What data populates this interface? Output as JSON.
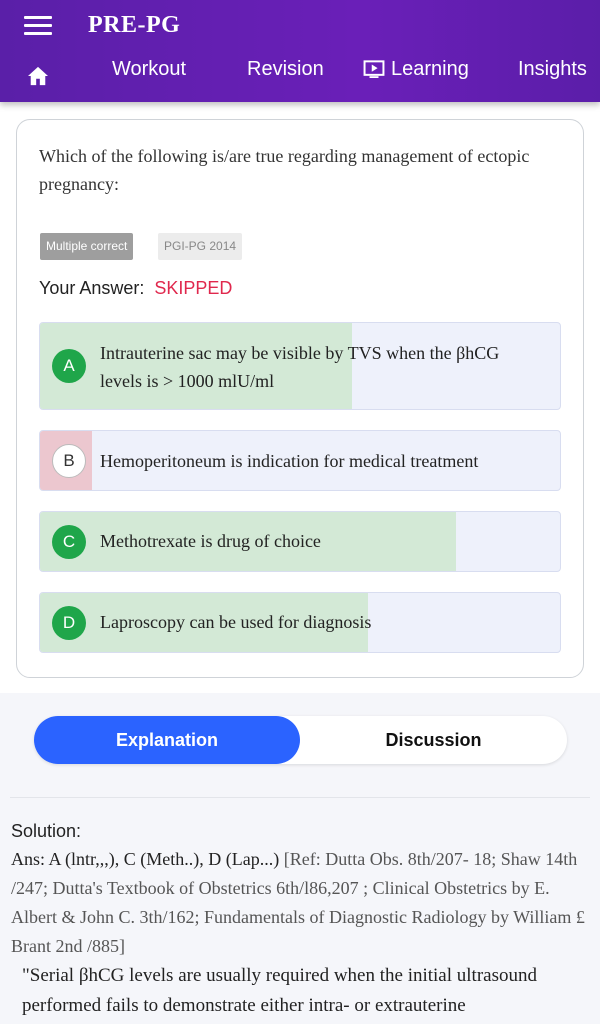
{
  "header": {
    "title": "PRE-PG",
    "nav": {
      "home_icon": "home-icon",
      "workout": "Workout",
      "revision": "Revision",
      "learning_icon": "play-screen-icon",
      "learning": "Learning",
      "insights": "Insights"
    }
  },
  "question": {
    "text": "Which of the following is/are true regarding management of ectopic pregnancy:",
    "type_tag": "Multiple correct",
    "source_tag": "PGI-PG 2014",
    "answer_label": "Your Answer:",
    "answer_value": "SKIPPED",
    "options": [
      {
        "letter": "A",
        "text": "Intrauterine sac may be visible by TVS when the βhCG levels is > 1000 mlU/ml",
        "response_share": 0.6,
        "status": "correct"
      },
      {
        "letter": "B",
        "text": "Hemoperitoneum is indication for medical treatment",
        "response_share": 0.1,
        "status": "incorrect"
      },
      {
        "letter": "C",
        "text": "Methotrexate is drug of choice",
        "response_share": 0.8,
        "status": "correct"
      },
      {
        "letter": "D",
        "text": "Laproscopy can be used for diagnosis",
        "response_share": 0.63,
        "status": "correct"
      }
    ]
  },
  "tabs": {
    "explanation": "Explanation",
    "discussion": "Discussion"
  },
  "solution": {
    "title": "Solution:",
    "answer": "Ans: A (lntr,,,), C (Meth..), D (Lap...)",
    "reference": " [Ref: Dutta Obs. 8th/207- 18; Shaw 14th /247; Dutta's Textbook of Obstetrics 6th/l86,207 ; Clinical Obstetrics by E. Albert & John C. 3th/162; Fundamentals of Diagnostic Radiology by William £ Brant 2nd /885]",
    "quote": "\"Serial βhCG levels are usually required when the initial ultrasound performed fails to demonstrate either intra- or extrauterine"
  },
  "colors": {
    "header": "#5a1fa8",
    "correct_fill": "#d3e9d6",
    "incorrect_fill": "#ecc7cf",
    "correct_badge": "#1fa64a",
    "skipped": "#e0284d",
    "tab_active": "#2b63ff"
  }
}
